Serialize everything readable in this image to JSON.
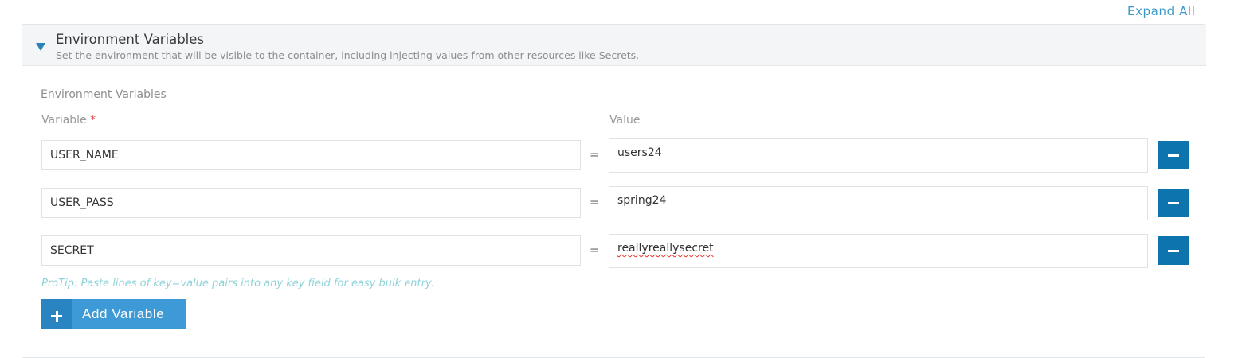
{
  "toolbar": {
    "expand_all_label": "Expand All"
  },
  "panel": {
    "title": "Environment Variables",
    "description": "Set the environment that will be visible to the container, including injecting values from other resources like Secrets.",
    "section_label": "Environment Variables",
    "variable_label": "Variable",
    "required_marker": "*",
    "value_label": "Value",
    "equals_sign": "=",
    "rows": [
      {
        "key": "USER_NAME",
        "value": "users24"
      },
      {
        "key": "USER_PASS",
        "value": "spring24"
      },
      {
        "key": "SECRET",
        "value": "reallyreallysecret"
      }
    ],
    "protip": "ProTip: Paste lines of key=value pairs into any key field for easy bulk entry.",
    "add_button_label": "Add Variable"
  },
  "icons": {
    "collapse": "caret-down-icon",
    "remove": "minus-icon",
    "add": "plus-icon"
  },
  "colors": {
    "accent": "#0d74ad",
    "add_button": "#3d9ad6",
    "link": "#3d98c8",
    "protip": "#8fd3d8",
    "required": "#d9534f"
  }
}
